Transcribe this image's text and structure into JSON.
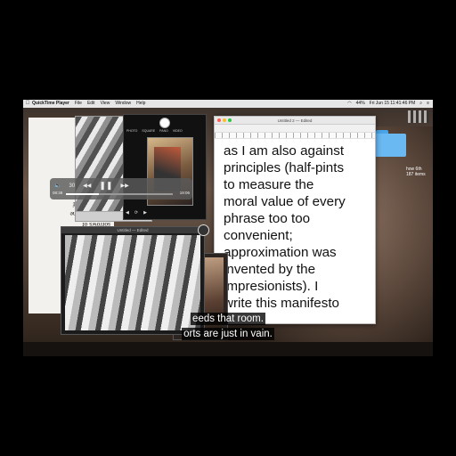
{
  "menubar": {
    "app_name": "QuickTime Player",
    "menus": [
      "File",
      "Edit",
      "View",
      "Window",
      "Help"
    ],
    "clock": "Fri Jun 15  11:41:46 PM",
    "battery": "44%"
  },
  "left_doc": {
    "lines_mirrored": [
      "the",
      "amusement of",
      "redpilled in the",
      "sorrows of",
      "conjugal life.",
      "To be plain. The",
      "Whence the",
      "be manipulated,",
      "slows his instincts,",
      "of serpentine",
      "complications, he",
      "his padded refuge"
    ]
  },
  "camera_window": {
    "modes": [
      "PHOTO",
      "SQUARE",
      "PANO",
      "VIDEO"
    ],
    "controls": [
      "◀",
      "⟳",
      "▶"
    ]
  },
  "editor_window": {
    "title": "Untitled 2 — Edited",
    "lines": [
      "as I am also against",
      "principles (half-pints",
      "to measure the",
      "moral value of every",
      "phrase too too",
      "convenient;",
      "approximation was",
      "invented by the",
      "impresionists). I",
      "write this manifesto"
    ]
  },
  "video_window": {
    "title": "Untitled — Edited",
    "controls": {
      "volume_icon": "🔈",
      "skip_back": "30",
      "rewind": "◀◀",
      "play_pause": "❚❚",
      "forward": "▶▶",
      "time_elapsed": "08:38",
      "time_remaining": "19:06",
      "progress": 0.31
    }
  },
  "desktop": {
    "label_a": "d a",
    "label_b_line1": "how 6th",
    "label_b_line2": "187 items"
  },
  "subtitles": {
    "line1": "eeds that room.",
    "line2": "orts are just in vain."
  }
}
